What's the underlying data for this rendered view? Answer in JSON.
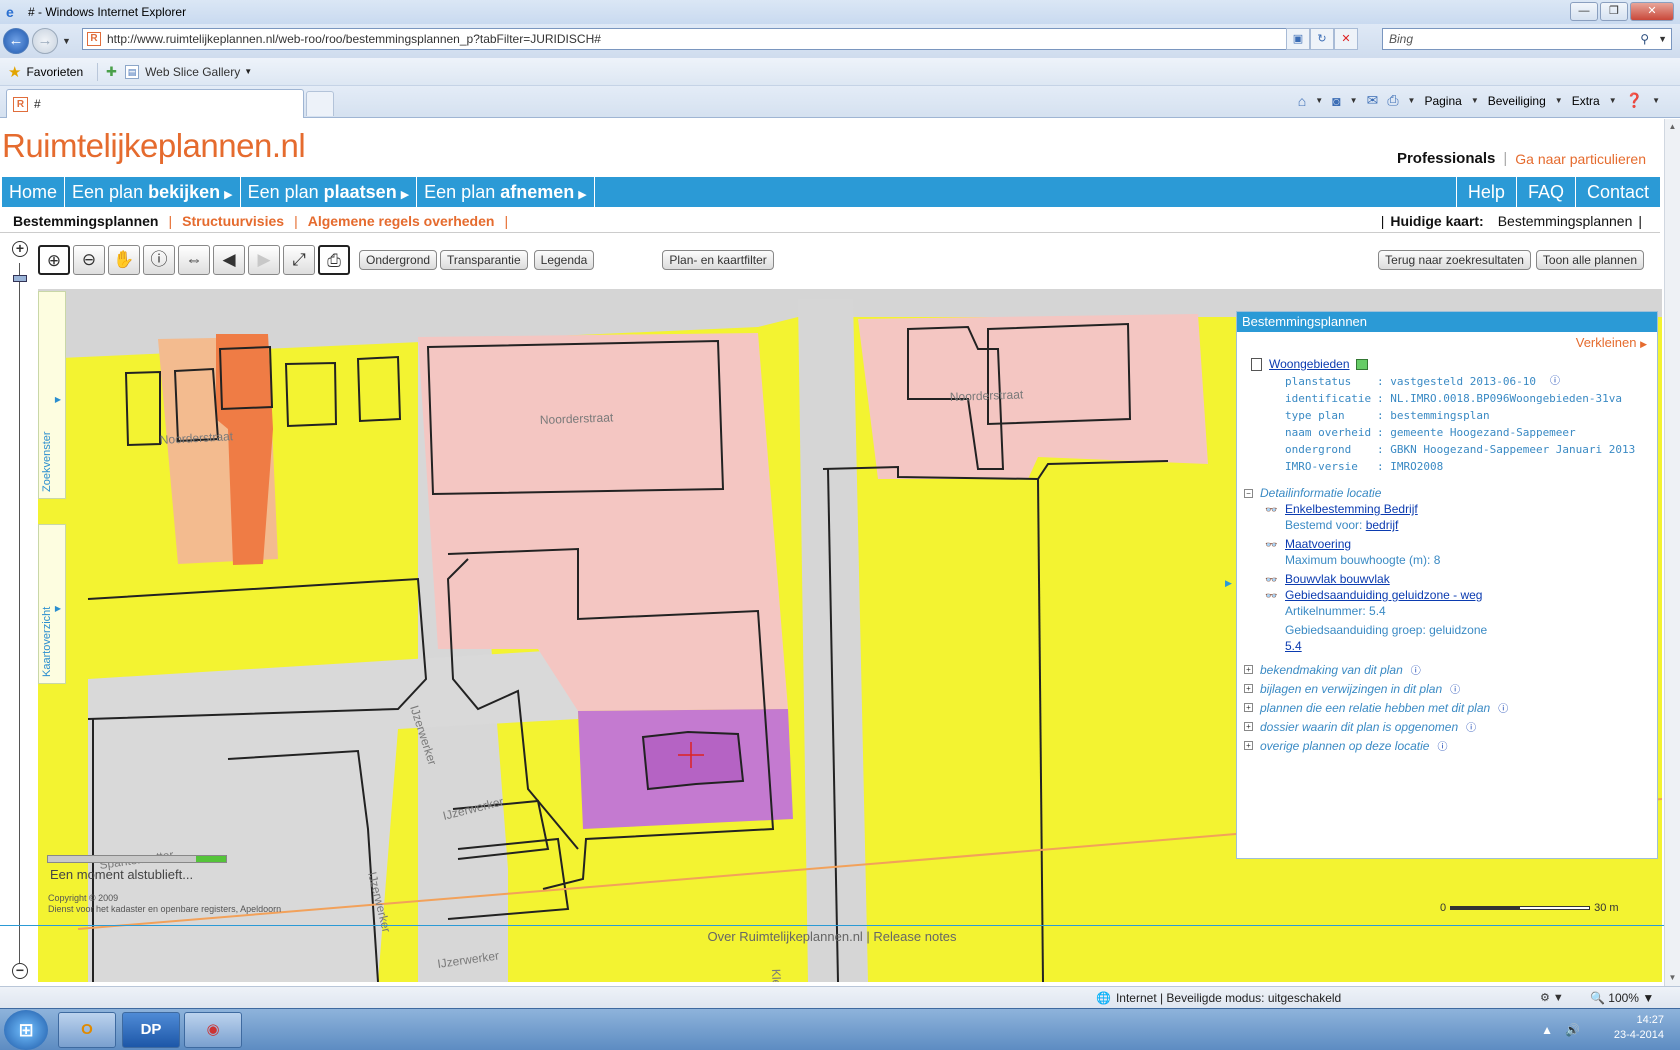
{
  "window": {
    "title": "# - Windows Internet Explorer"
  },
  "address": {
    "url": "http://www.ruimtelijkeplannen.nl/web-roo/roo/bestemmingsplannen_p?tabFilter=JURIDISCH#",
    "search_placeholder": "Bing"
  },
  "favorites": {
    "label": "Favorieten",
    "web_slice": "Web Slice Gallery"
  },
  "tab": {
    "title": "#"
  },
  "commands": {
    "page": "Pagina",
    "security": "Beveiliging",
    "extra": "Extra"
  },
  "site": {
    "logo": "Ruimtelijkeplannen.nl",
    "audience_active": "Professionals",
    "audience_link": "Ga naar particulieren"
  },
  "mainnav": {
    "home": "Home",
    "view_pre": "Een plan ",
    "view_bold": "bekijken",
    "place_pre": "Een plan ",
    "place_bold": "plaatsen",
    "take_pre": "Een plan ",
    "take_bold": "afnemen",
    "help": "Help",
    "faq": "FAQ",
    "contact": "Contact"
  },
  "subnav": {
    "current": "Bestemmingsplannen",
    "structuur": "Structuurvisies",
    "algemene": "Algemene regels overheden",
    "map_label": "Huidige kaart:",
    "map_value": "Bestemmingsplannen"
  },
  "maptools": {
    "ondergrond": "Ondergrond",
    "transparantie": "Transparantie",
    "legenda": "Legenda",
    "filter": "Plan- en kaartfilter",
    "back_results": "Terug naar zoekresultaten",
    "show_all": "Toon alle plannen"
  },
  "map": {
    "streets": [
      "Noorderstraat",
      "Noorderstraat",
      "Noorderstraat",
      "IJzerwerker",
      "IJzerwerker",
      "IJzerwerker",
      "IJzerwerker",
      "Spantenzetter",
      "Kle"
    ],
    "tab_zoek": "Zoekvenster",
    "tab_kaart": "Kaartoverzicht",
    "loading": "Een moment alstublieft...",
    "copyright_1": "Copyright © 2009",
    "copyright_2": "Dienst voor het kadaster en openbare registers, Apeldoorn",
    "scale_start": "0",
    "scale_end": "30 m"
  },
  "panel": {
    "title": "Bestemmingsplannen",
    "shrink": "Verkleinen",
    "plan_name": "Woongebieden",
    "meta": [
      {
        "k": "planstatus",
        "v": ": vastgesteld 2013-06-10"
      },
      {
        "k": "identificatie",
        "v": ": NL.IMRO.0018.BP096Woongebieden-31va"
      },
      {
        "k": "type plan",
        "v": ": bestemmingsplan"
      },
      {
        "k": "naam overheid",
        "v": ": gemeente Hoogezand-Sappemeer"
      },
      {
        "k": "ondergrond",
        "v": ": GBKN Hoogezand-Sappemeer Januari 2013"
      },
      {
        "k": "IMRO-versie",
        "v": ": IMRO2008"
      }
    ],
    "detail_header": "Detailinformatie locatie",
    "details": {
      "enkel": "Enkelbestemming Bedrijf",
      "bestemd_label": "Bestemd voor: ",
      "bestemd_value": "bedrijf",
      "maatvoering": "Maatvoering",
      "max_height": "Maximum bouwhoogte (m): 8",
      "bouwvlak": "Bouwvlak bouwvlak",
      "geluid": "Gebiedsaanduiding geluidzone - weg",
      "artikel": "Artikelnummer: 5.4",
      "groep": "Gebiedsaanduiding groep: geluidzone",
      "groep_link": "5.4"
    },
    "sections": [
      "bekendmaking van dit plan",
      "bijlagen en verwijzingen in dit plan",
      "plannen die een relatie hebben met dit plan",
      "dossier waarin dit plan is opgenomen",
      "overige plannen op deze locatie"
    ]
  },
  "footer": {
    "about": "Over Ruimtelijkeplannen.nl",
    "sep": " | ",
    "release": "Release notes"
  },
  "status": {
    "zone": "Internet | Beveiligde modus: uitgeschakeld",
    "zoom": "100%"
  },
  "tray": {
    "time": "14:27",
    "date": "23-4-2014"
  },
  "colors": {
    "brand_orange": "#e56b2e",
    "nav_blue": "#2b9ad6",
    "map_yellow": "#f3f331",
    "map_pink": "#f4c6c2",
    "map_purple": "#c47ad0"
  }
}
